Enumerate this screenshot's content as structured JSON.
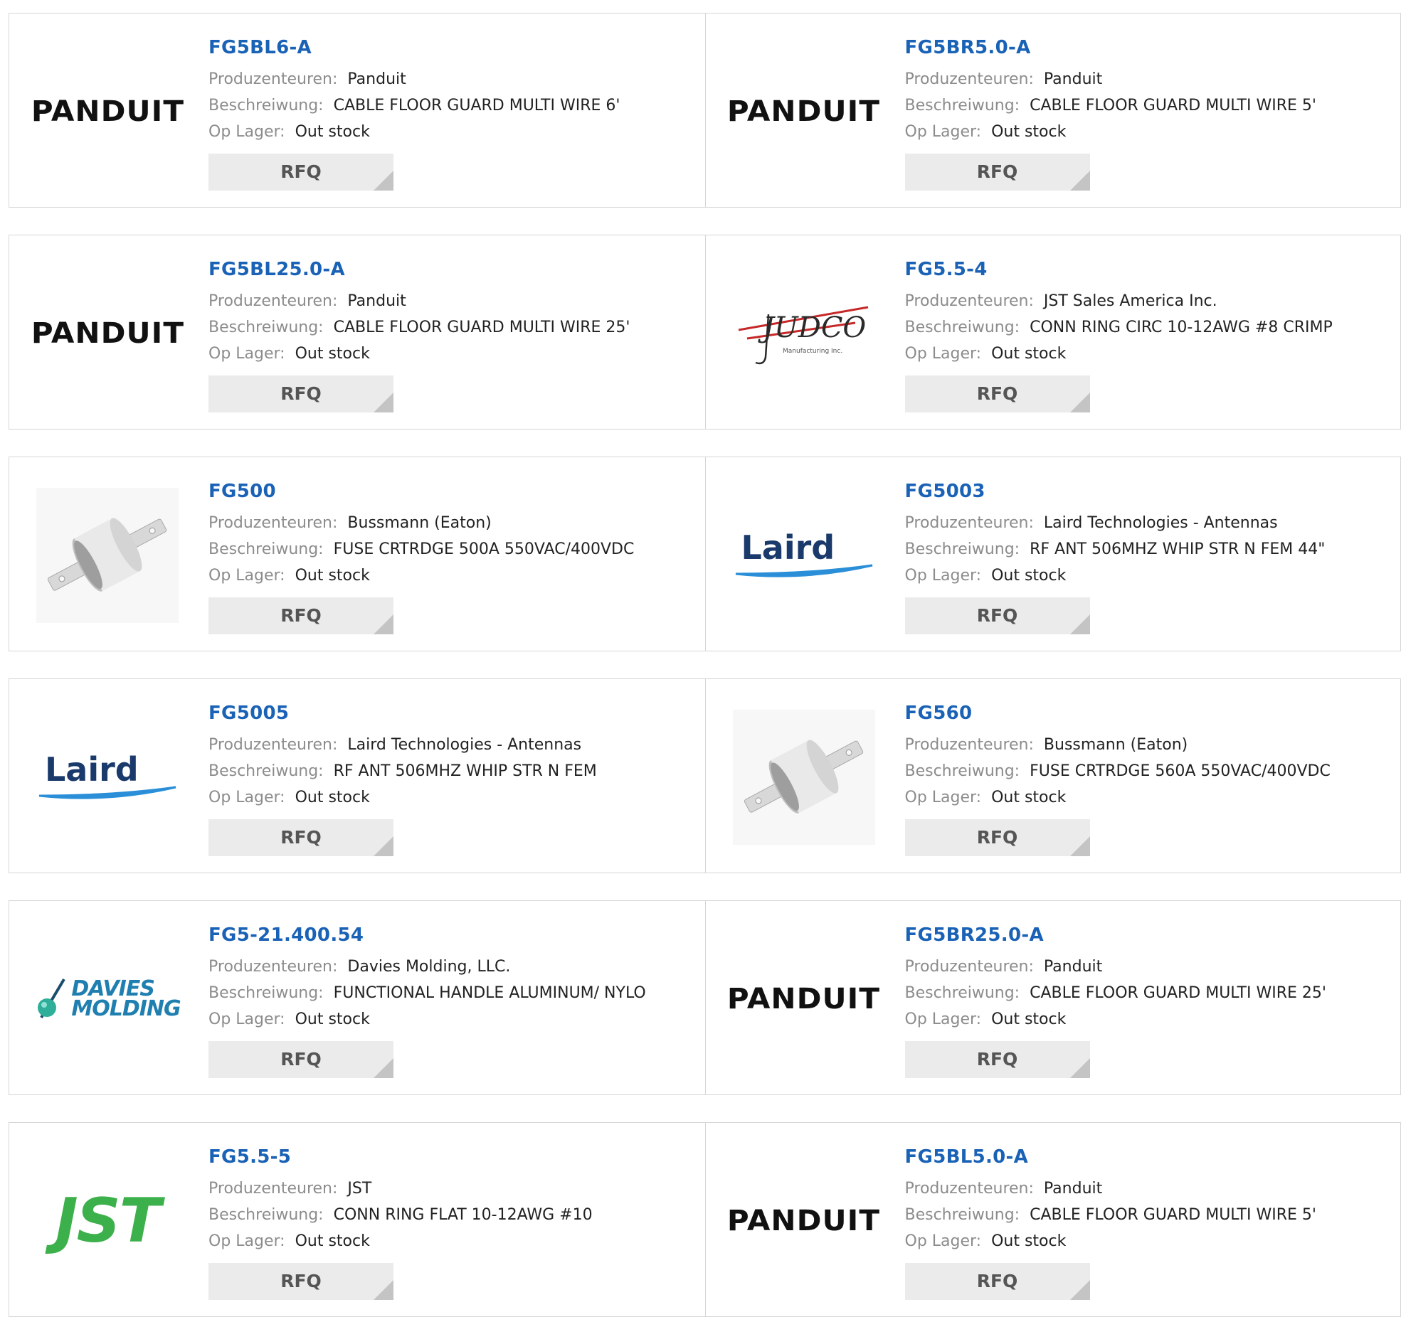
{
  "labels": {
    "manufacturer": "Produzenteuren:",
    "description": "Beschreiwung:",
    "stock": "Op Lager:",
    "rfq": "RFQ"
  },
  "logos": {
    "panduit": "PANDUIT",
    "laird": "Laird",
    "jst": "JST",
    "davies_line1": "DAVIES",
    "davies_line2": "MOLDING",
    "judco": "JUDCO",
    "judco_sub": "Manufacturing Inc."
  },
  "colors": {
    "link": "#1a62b6",
    "label": "#8c8c8c",
    "value": "#222222",
    "button_bg": "#ebebeb",
    "border": "#d6d6d6"
  },
  "products": [
    {
      "part": "FG5BL6-A",
      "manufacturer": "Panduit",
      "description": "CABLE FLOOR GUARD MULTI WIRE 6'",
      "stock": "Out stock",
      "logo": "panduit-logo"
    },
    {
      "part": "FG5BR5.0-A",
      "manufacturer": "Panduit",
      "description": "CABLE FLOOR GUARD MULTI WIRE 5'",
      "stock": "Out stock",
      "logo": "panduit-logo"
    },
    {
      "part": "FG5BL25.0-A",
      "manufacturer": "Panduit",
      "description": "CABLE FLOOR GUARD MULTI WIRE 25'",
      "stock": "Out stock",
      "logo": "panduit-logo"
    },
    {
      "part": "FG5.5-4",
      "manufacturer": "JST Sales America Inc.",
      "description": "CONN RING CIRC 10-12AWG #8 CRIMP",
      "stock": "Out stock",
      "logo": "judco-logo"
    },
    {
      "part": "FG500",
      "manufacturer": "Bussmann (Eaton)",
      "description": "FUSE CRTRDGE 500A 550VAC/400VDC",
      "stock": "Out stock",
      "logo": "fuse-product-image"
    },
    {
      "part": "FG5003",
      "manufacturer": "Laird Technologies - Antennas",
      "description": "RF ANT 506MHZ WHIP STR N FEM 44\"",
      "stock": "Out stock",
      "logo": "laird-logo"
    },
    {
      "part": "FG5005",
      "manufacturer": "Laird Technologies - Antennas",
      "description": "RF ANT 506MHZ WHIP STR N FEM",
      "stock": "Out stock",
      "logo": "laird-logo"
    },
    {
      "part": "FG560",
      "manufacturer": "Bussmann (Eaton)",
      "description": "FUSE CRTRDGE 560A 550VAC/400VDC",
      "stock": "Out stock",
      "logo": "fuse-product-image"
    },
    {
      "part": "FG5-21.400.54",
      "manufacturer": "Davies Molding, LLC.",
      "description": "FUNCTIONAL HANDLE ALUMINUM/ NYLO",
      "stock": "Out stock",
      "logo": "davies-molding-logo"
    },
    {
      "part": "FG5BR25.0-A",
      "manufacturer": "Panduit",
      "description": "CABLE FLOOR GUARD MULTI WIRE 25'",
      "stock": "Out stock",
      "logo": "panduit-logo"
    },
    {
      "part": "FG5.5-5",
      "manufacturer": "JST",
      "description": "CONN RING FLAT 10-12AWG #10",
      "stock": "Out stock",
      "logo": "jst-logo"
    },
    {
      "part": "FG5BL5.0-A",
      "manufacturer": "Panduit",
      "description": "CABLE FLOOR GUARD MULTI WIRE 5'",
      "stock": "Out stock",
      "logo": "panduit-logo"
    }
  ]
}
